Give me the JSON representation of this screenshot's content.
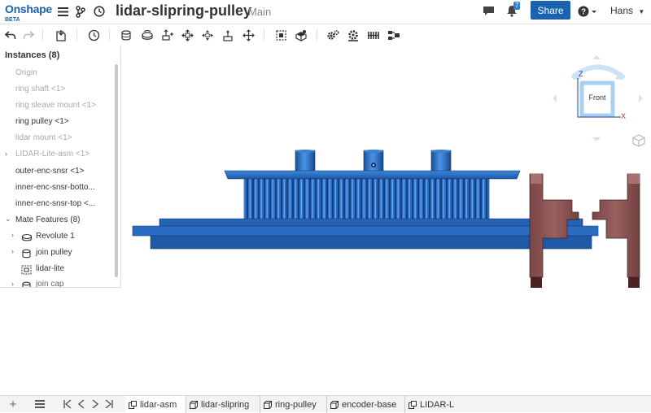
{
  "header": {
    "logo": "Onshape",
    "logo_sub": "BETA",
    "doc_title": "lidar-slipring-pulley",
    "branch": "Main",
    "share_label": "Share",
    "notification_count": "7",
    "user_name": "Hans"
  },
  "toolbar": {
    "tools": [
      "undo-icon",
      "redo-icon",
      "insert-part-icon",
      "history-icon",
      "fastened-mate-icon",
      "revolute-mate-icon",
      "slider-mate-icon",
      "planar-mate-icon",
      "cylindrical-mate-icon",
      "pin-slot-mate-icon",
      "ball-mate-icon",
      "parallel-mate-icon",
      "mate-connector-icon",
      "group-icon",
      "settings-icon",
      "gear-relation-icon",
      "rack-pinion-icon",
      "linear-pattern-icon"
    ]
  },
  "instances_panel": {
    "title": "Instances (8)",
    "items": [
      {
        "label": "Origin",
        "style": "dim",
        "has_caret": false
      },
      {
        "label": "ring shaft <1>",
        "style": "dim",
        "has_caret": false
      },
      {
        "label": "ring sleave mount <1>",
        "style": "dim",
        "has_caret": false
      },
      {
        "label": "ring pulley <1>",
        "style": "normal",
        "has_caret": false
      },
      {
        "label": "lidar mount <1>",
        "style": "dim",
        "has_caret": false
      },
      {
        "label": "LIDAR-Lite-asm <1>",
        "style": "dim",
        "has_caret": true
      },
      {
        "label": "outer-enc-snsr <1>",
        "style": "normal",
        "has_caret": false
      },
      {
        "label": "inner-enc-snsr-botto...",
        "style": "normal",
        "has_caret": false
      },
      {
        "label": "inner-enc-snsr-top <...",
        "style": "normal",
        "has_caret": false
      }
    ],
    "mate_features_label": "Mate Features (8)",
    "mates": [
      {
        "label": "Revolute 1",
        "icon": "revolute-mate-icon"
      },
      {
        "label": "join pulley",
        "icon": "fastened-mate-icon"
      },
      {
        "label": "lidar-lite",
        "icon": "group-icon"
      },
      {
        "label": "join cap",
        "icon": "fastened-mate-icon"
      }
    ]
  },
  "view_cube": {
    "face_label": "Front",
    "axis_z": "Z",
    "axis_x": "X"
  },
  "tabs": [
    {
      "label": "lidar-asm",
      "active": true
    },
    {
      "label": "lidar-slipring",
      "active": false
    },
    {
      "label": "ring-pulley",
      "active": false
    },
    {
      "label": "encoder-base",
      "active": false
    },
    {
      "label": "LIDAR-L",
      "active": false
    }
  ],
  "colors": {
    "brand": "#1a62b0",
    "part_blue": "#1f62b5",
    "part_brown": "#8a5555"
  }
}
